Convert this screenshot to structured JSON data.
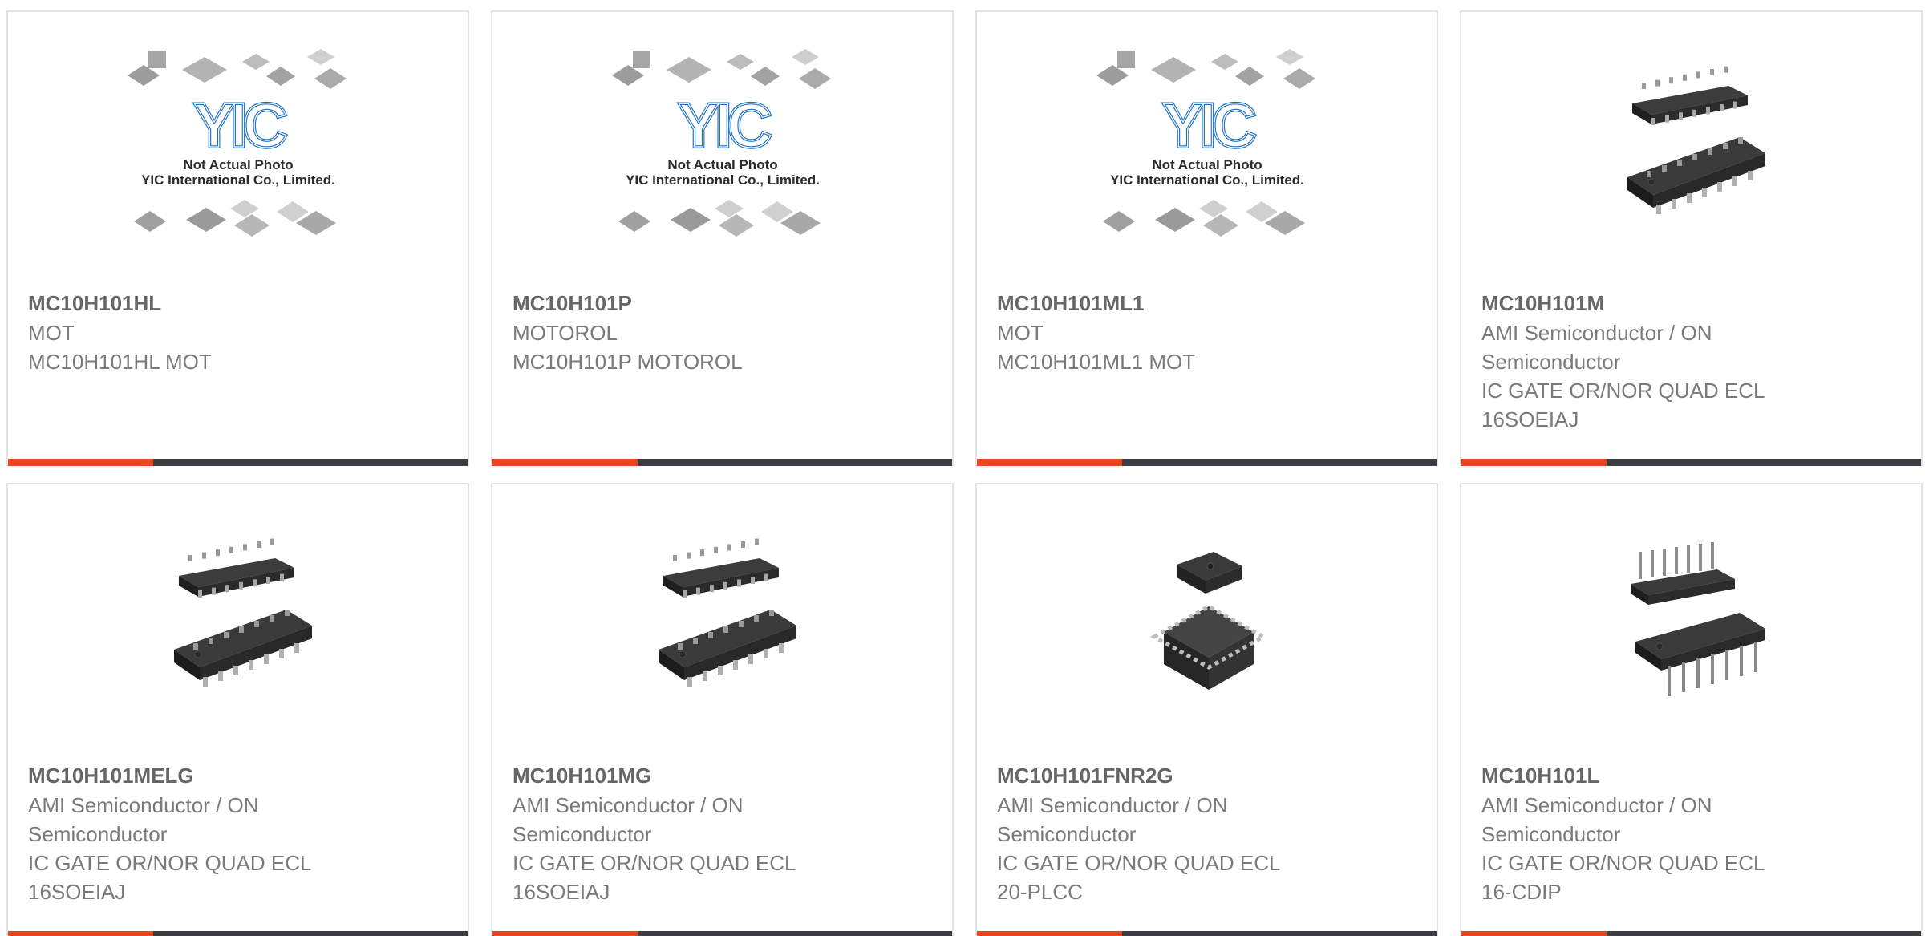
{
  "products": [
    {
      "part_number": "MC10H101HL",
      "lines": [
        "MOT",
        "MC10H101HL MOT"
      ],
      "image": "placeholder",
      "placeholder_caption": [
        "Not Actual Photo",
        "YIC International Co., Limited."
      ],
      "placeholder_logo": "YIC"
    },
    {
      "part_number": "MC10H101P",
      "lines": [
        "MOTOROL",
        "MC10H101P MOTOROL"
      ],
      "image": "placeholder",
      "placeholder_caption": [
        "Not Actual Photo",
        "YIC International Co., Limited."
      ],
      "placeholder_logo": "YIC"
    },
    {
      "part_number": "MC10H101ML1",
      "lines": [
        "MOT",
        "MC10H101ML1 MOT"
      ],
      "image": "placeholder",
      "placeholder_caption": [
        "Not Actual Photo",
        "YIC International Co., Limited."
      ],
      "placeholder_logo": "YIC"
    },
    {
      "part_number": "MC10H101M",
      "lines": [
        "AMI Semiconductor / ON",
        "Semiconductor",
        "IC GATE OR/NOR QUAD ECL",
        "16SOEIAJ"
      ],
      "image": "soic-chip-icon"
    },
    {
      "part_number": "MC10H101MELG",
      "lines": [
        "AMI Semiconductor / ON",
        "Semiconductor",
        "IC GATE OR/NOR QUAD ECL",
        "16SOEIAJ"
      ],
      "image": "soic-chip-icon"
    },
    {
      "part_number": "MC10H101MG",
      "lines": [
        "AMI Semiconductor / ON",
        "Semiconductor",
        "IC GATE OR/NOR QUAD ECL",
        "16SOEIAJ"
      ],
      "image": "soic-chip-icon"
    },
    {
      "part_number": "MC10H101FNR2G",
      "lines": [
        "AMI Semiconductor / ON",
        "Semiconductor",
        "IC GATE OR/NOR QUAD ECL",
        "20-PLCC"
      ],
      "image": "plcc-chip-icon"
    },
    {
      "part_number": "MC10H101L",
      "lines": [
        "AMI Semiconductor / ON",
        "Semiconductor",
        "IC GATE OR/NOR QUAD ECL",
        "16-CDIP"
      ],
      "image": "dip-chip-icon"
    }
  ],
  "colors": {
    "accent_orange": "#e8461c",
    "accent_dark": "#3b3d42",
    "text_title": "#666666",
    "text_body": "#7a7a7a",
    "card_border": "#e3e3e3"
  }
}
